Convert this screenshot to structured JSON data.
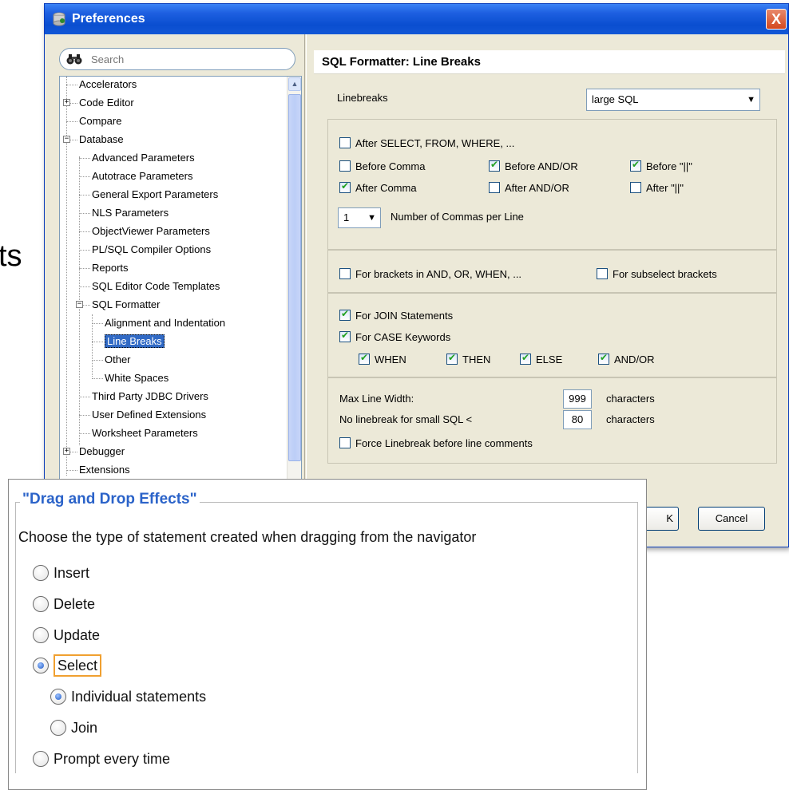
{
  "background_fragment": "ts",
  "prefs": {
    "title": "Preferences",
    "search_placeholder": "Search",
    "close_label": "X",
    "tree": [
      {
        "label": "Accelerators"
      },
      {
        "label": "Code Editor"
      },
      {
        "label": "Compare"
      },
      {
        "label": "Database"
      },
      {
        "label": "Advanced Parameters"
      },
      {
        "label": "Autotrace Parameters"
      },
      {
        "label": "General Export Parameters"
      },
      {
        "label": "NLS Parameters"
      },
      {
        "label": "ObjectViewer Parameters"
      },
      {
        "label": "PL/SQL Compiler Options"
      },
      {
        "label": "Reports"
      },
      {
        "label": "SQL Editor Code Templates"
      },
      {
        "label": "SQL Formatter"
      },
      {
        "label": "Alignment and Indentation"
      },
      {
        "label": "Line Breaks"
      },
      {
        "label": "Other"
      },
      {
        "label": "White Spaces"
      },
      {
        "label": "Third Party JDBC Drivers"
      },
      {
        "label": "User Defined Extensions"
      },
      {
        "label": "Worksheet Parameters"
      },
      {
        "label": "Debugger"
      },
      {
        "label": "Extensions"
      }
    ],
    "heading": "SQL Formatter: Line Breaks",
    "linebreaks_label": "Linebreaks",
    "linebreaks_value": "large SQL",
    "after_select": "After SELECT, FROM, WHERE, ...",
    "before_comma": "Before Comma",
    "before_andor": "Before  AND/OR",
    "before_pipes": "Before  \"||\"",
    "after_comma": "After Comma",
    "after_andor": "After AND/OR",
    "after_pipes": "After  \"||\"",
    "commas_value": "1",
    "commas_label": "Number of Commas per Line",
    "brackets_andor": "For brackets in AND, OR, WHEN, ...",
    "subselect_brackets": "For subselect brackets",
    "join_statements": "For JOIN Statements",
    "case_keywords": "For CASE Keywords",
    "when": "WHEN",
    "then": "THEN",
    "else": "ELSE",
    "andor": "AND/OR",
    "max_line_width_label": "Max Line Width:",
    "max_line_width_value": "999",
    "characters_1": "characters",
    "no_linebreak_label": "No linebreak for small SQL <",
    "no_linebreak_value": "80",
    "characters_2": "characters",
    "force_linebreak": "Force Linebreak before line comments",
    "ok_partial": "K",
    "cancel": "Cancel"
  },
  "dnd": {
    "title": "\"Drag and Drop Effects\"",
    "description": "Choose the type of statement created when dragging from the navigator",
    "options": [
      "Insert",
      "Delete",
      "Update",
      "Select",
      "Individual statements",
      "Join",
      "Prompt every time"
    ]
  }
}
